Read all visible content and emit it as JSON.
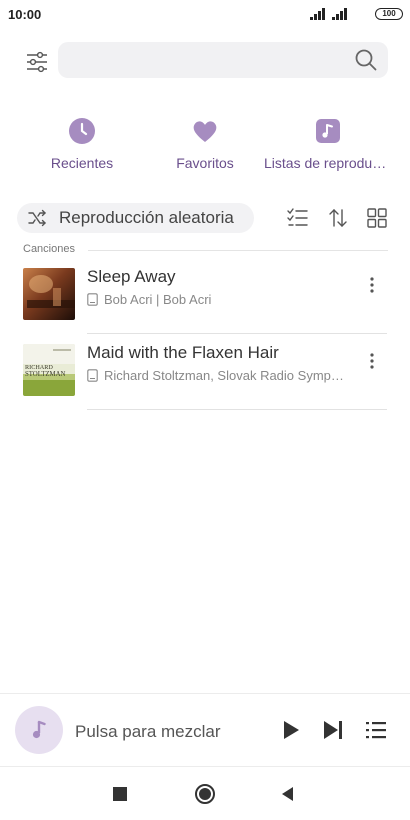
{
  "status_bar": {
    "time": "10:00",
    "battery": "100"
  },
  "search": {
    "placeholder": ""
  },
  "categories": [
    {
      "label": "Recientes",
      "icon": "clock-icon"
    },
    {
      "label": "Favoritos",
      "icon": "heart-icon"
    },
    {
      "label": "Listas de reproducción",
      "icon": "music-note-icon"
    }
  ],
  "controls": {
    "shuffle_label": "Reproducción aleatoria"
  },
  "section": {
    "label": "Canciones"
  },
  "songs": [
    {
      "title": "Sleep Away",
      "artist": "Bob Acri | Bob Acri"
    },
    {
      "title": "Maid with the Flaxen Hair",
      "artist": "Richard Stoltzman, Slovak Radio Symphony Orchestra"
    }
  ],
  "cover_text": {
    "line1": "RICHARD",
    "line2": "STOLTZMAN"
  },
  "player": {
    "text": "Pulsa para mezclar"
  },
  "colors": {
    "accent": "#a68cc0",
    "accent_text": "#6a4f8c"
  }
}
